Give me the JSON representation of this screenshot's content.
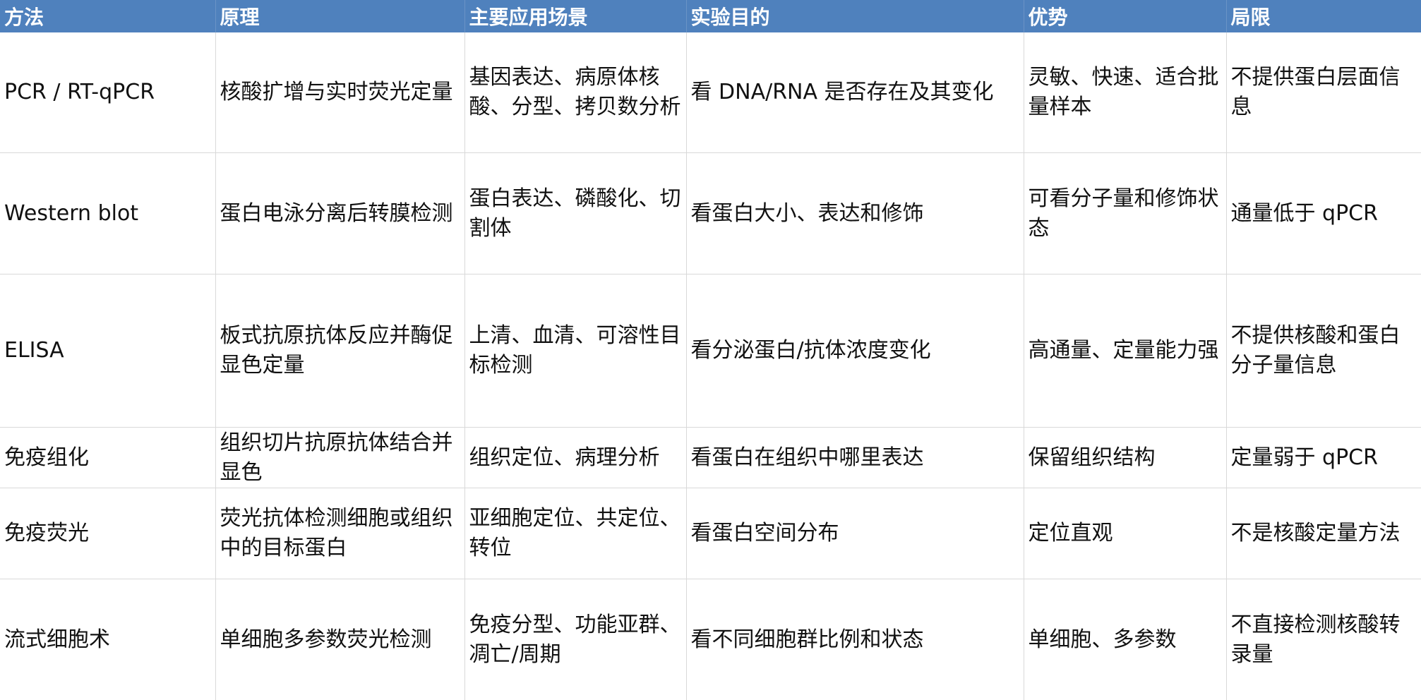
{
  "headers": [
    "方法",
    "原理",
    "主要应用场景",
    "实验目的",
    "优势",
    "局限"
  ],
  "rows": [
    [
      "PCR / RT-qPCR",
      "核酸扩增与实时荧光定量",
      "基因表达、病原体核酸、分型、拷贝数分析",
      "看 DNA/RNA 是否存在及其变化",
      "灵敏、快速、适合批量样本",
      "不提供蛋白层面信息"
    ],
    [
      "Western blot",
      "蛋白电泳分离后转膜检测",
      "蛋白表达、磷酸化、切割体",
      "看蛋白大小、表达和修饰",
      "可看分子量和修饰状态",
      "通量低于 qPCR"
    ],
    [
      "ELISA",
      "板式抗原抗体反应并酶促显色定量",
      "上清、血清、可溶性目标检测",
      "看分泌蛋白/抗体浓度变化",
      "高通量、定量能力强",
      "不提供核酸和蛋白分子量信息"
    ],
    [
      "免疫组化",
      "组织切片抗原抗体结合并显色",
      "组织定位、病理分析",
      "看蛋白在组织中哪里表达",
      "保留组织结构",
      "定量弱于 qPCR"
    ],
    [
      "免疫荧光",
      "荧光抗体检测细胞或组织中的目标蛋白",
      "亚细胞定位、共定位、转位",
      "看蛋白空间分布",
      "定位直观",
      "不是核酸定量方法"
    ],
    [
      "流式细胞术",
      "单细胞多参数荧光检测",
      "免疫分型、功能亚群、凋亡/周期",
      "看不同细胞群比例和状态",
      "单细胞、多参数",
      "不直接检测核酸转录量"
    ]
  ]
}
